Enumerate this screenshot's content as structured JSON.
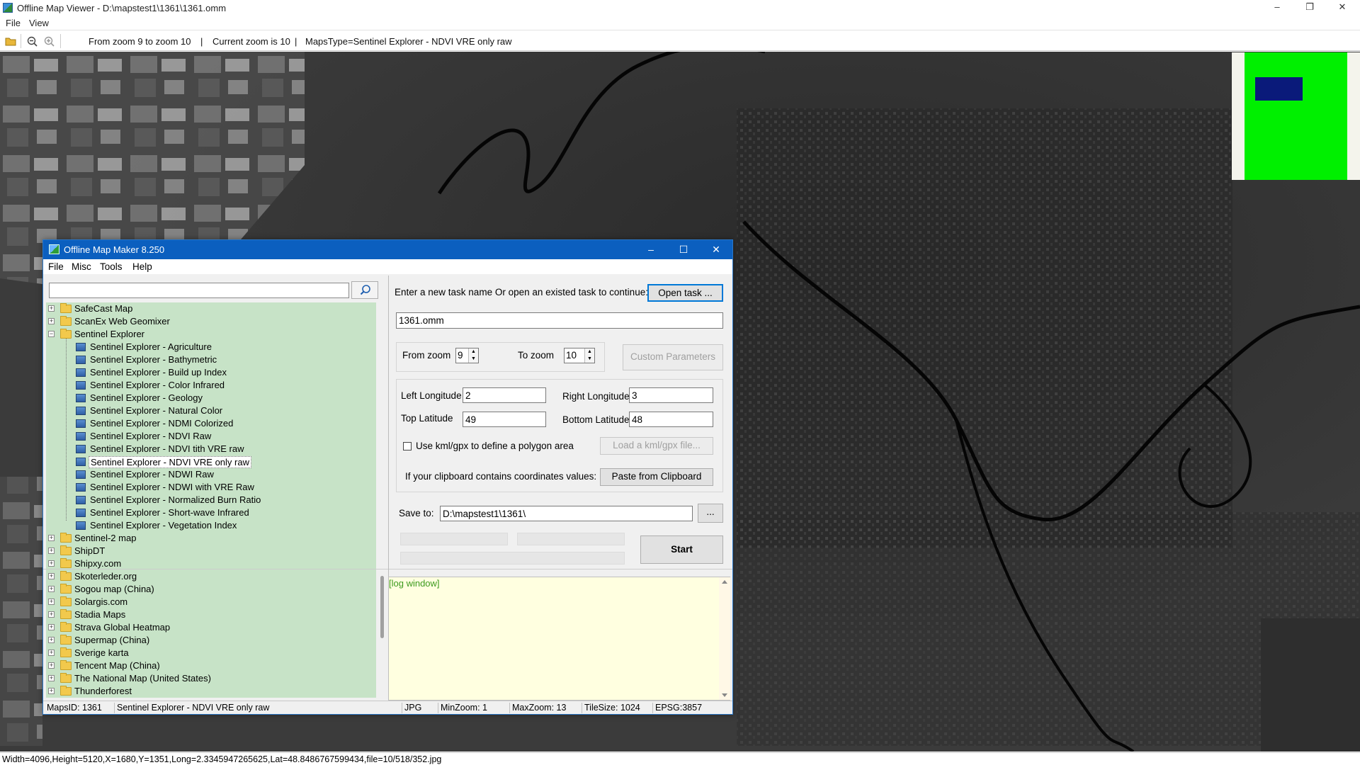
{
  "window": {
    "title": "Offline Map Viewer - D:\\mapstest1\\1361\\1361.omm",
    "controls": {
      "minimize": "–",
      "maximize": "❐",
      "close": "✕"
    }
  },
  "menu": [
    "File",
    "View"
  ],
  "toolbar": {
    "icons": [
      "open-folder-icon",
      "zoom-out-icon",
      "zoom-in-icon"
    ],
    "zoom_range": "From zoom 9 to zoom 10",
    "current_zoom": "Current zoom is 10",
    "maps_type": "MapsType=Sentinel Explorer - NDVI VRE only raw",
    "sep1": "|",
    "sep2": "|"
  },
  "minimap": {
    "background": "#00f000",
    "viewport": "#0a1a7a"
  },
  "status_bar": "Width=4096,Height=5120,X=1680,Y=1351,Long=2.3345947265625,Lat=48.8486767599434,file=10/518/352.jpg",
  "dialog": {
    "title": "Offline Map Maker 8.250",
    "controls": {
      "minimize": "–",
      "maximize": "☐",
      "close": "✕"
    },
    "menu": [
      "File",
      "Misc",
      "Tools",
      "Help"
    ],
    "search": {
      "value": "",
      "placeholder": ""
    },
    "tree": {
      "before": [
        "SafeCast Map",
        "ScanEx Web Geomixer"
      ],
      "expanded": "Sentinel Explorer",
      "children": [
        "Sentinel Explorer - Agriculture",
        "Sentinel Explorer - Bathymetric",
        "Sentinel Explorer - Build up Index",
        "Sentinel Explorer - Color Infrared",
        "Sentinel Explorer - Geology",
        "Sentinel Explorer - Natural Color",
        "Sentinel Explorer - NDMI Colorized",
        "Sentinel Explorer - NDVI Raw",
        "Sentinel Explorer - NDVI tith VRE raw",
        "Sentinel Explorer - NDVI VRE only raw",
        "Sentinel Explorer - NDWI Raw",
        "Sentinel Explorer - NDWI with VRE Raw",
        "Sentinel Explorer - Normalized Burn Ratio",
        "Sentinel Explorer - Short-wave Infrared",
        "Sentinel Explorer - Vegetation Index"
      ],
      "selected": "Sentinel Explorer - NDVI VRE only raw",
      "after": [
        "Sentinel-2 map",
        "ShipDT",
        "Shipxy.com",
        "Skoterleder.org",
        "Sogou map (China)",
        "Solargis.com",
        "Stadia Maps",
        "Strava Global Heatmap",
        "Supermap (China)",
        "Sverige karta",
        "Tencent Map (China)",
        "The National Map (United States)",
        "Thunderforest"
      ]
    },
    "task": {
      "prompt": "Enter a new task name Or open an existed task to continue:",
      "open_button": "Open task ...",
      "name": "1361.omm"
    },
    "zoom": {
      "from_label": "From zoom",
      "from_value": "9",
      "to_label": "To zoom",
      "to_value": "10",
      "custom_button": "Custom Parameters"
    },
    "coords": {
      "left_lon_label": "Left Longitude",
      "left_lon": "2",
      "right_lon_label": "Right Longitude",
      "right_lon": "3",
      "top_lat_label": "Top Latitude",
      "top_lat": "49",
      "bottom_lat_label": "Bottom Latitude",
      "bottom_lat": "48",
      "kml_label": "Use kml/gpx to define a polygon area",
      "kml_checked": false,
      "kml_button": "Load a kml/gpx file...",
      "clip_label": "If your clipboard contains coordinates values:",
      "clip_button": "Paste from Clipboard"
    },
    "save": {
      "label": "Save to:",
      "path": "D:\\mapstest1\\1361\\",
      "browse_button": "...",
      "start_button": "Start"
    },
    "log": "[log window]",
    "status": {
      "maps_id": "MapsID: 1361",
      "map_name": "Sentinel Explorer - NDVI VRE only raw",
      "format": "JPG",
      "min_zoom": "MinZoom: 1",
      "max_zoom": "MaxZoom: 13",
      "tile_size": "TileSize: 1024",
      "epsg": "EPSG:3857"
    }
  }
}
